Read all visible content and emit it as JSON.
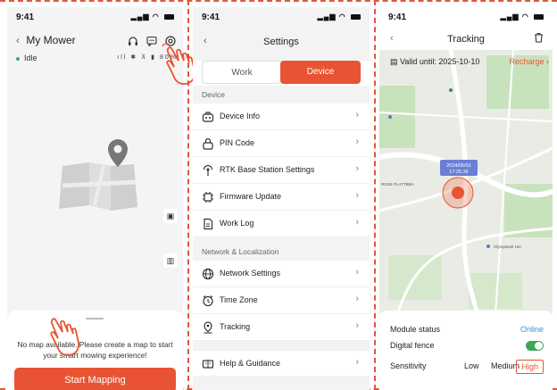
{
  "screen1": {
    "time": "9:41",
    "title": "My Mower",
    "status": "Idle",
    "battery": "80%",
    "no_map_message": "No map available. Please create a map to start your smart mowing experience!",
    "start_button": "Start Mapping"
  },
  "screen2": {
    "time": "9:41",
    "title": "Settings",
    "tab_work": "Work",
    "tab_device": "Device",
    "section_device": "Device",
    "items_device": [
      "Device Info",
      "PIN Code",
      "RTK Base Station Settings",
      "Firmware Update",
      "Work Log"
    ],
    "section_network": "Network & Localization",
    "items_network": [
      "Network Settings",
      "Time Zone",
      "Tracking"
    ],
    "help": "Help & Guidance"
  },
  "screen3": {
    "time": "9:41",
    "title": "Tracking",
    "valid_until": "Valid until: 2025-10-10",
    "recharge": "Recharge",
    "map_date": "2024/05/01",
    "map_time": "17:25:36",
    "map_label_left": "ROSE PLATTBBA",
    "map_label_bottom": "Olympiaset Her",
    "module_status_label": "Module status",
    "module_status_value": "Online",
    "digital_fence_label": "Digital fence",
    "digital_fence_on": true,
    "sensitivity_label": "Sensitivity",
    "sensitivity_options": [
      "Low",
      "Medium",
      "High"
    ],
    "sensitivity_selected": "High"
  },
  "colors": {
    "accent": "#e85433",
    "online": "#3b90d8",
    "toggle": "#3ba859",
    "map_land": "#e9ece4",
    "map_road": "#ffffff",
    "map_green": "#c8e2bd"
  }
}
